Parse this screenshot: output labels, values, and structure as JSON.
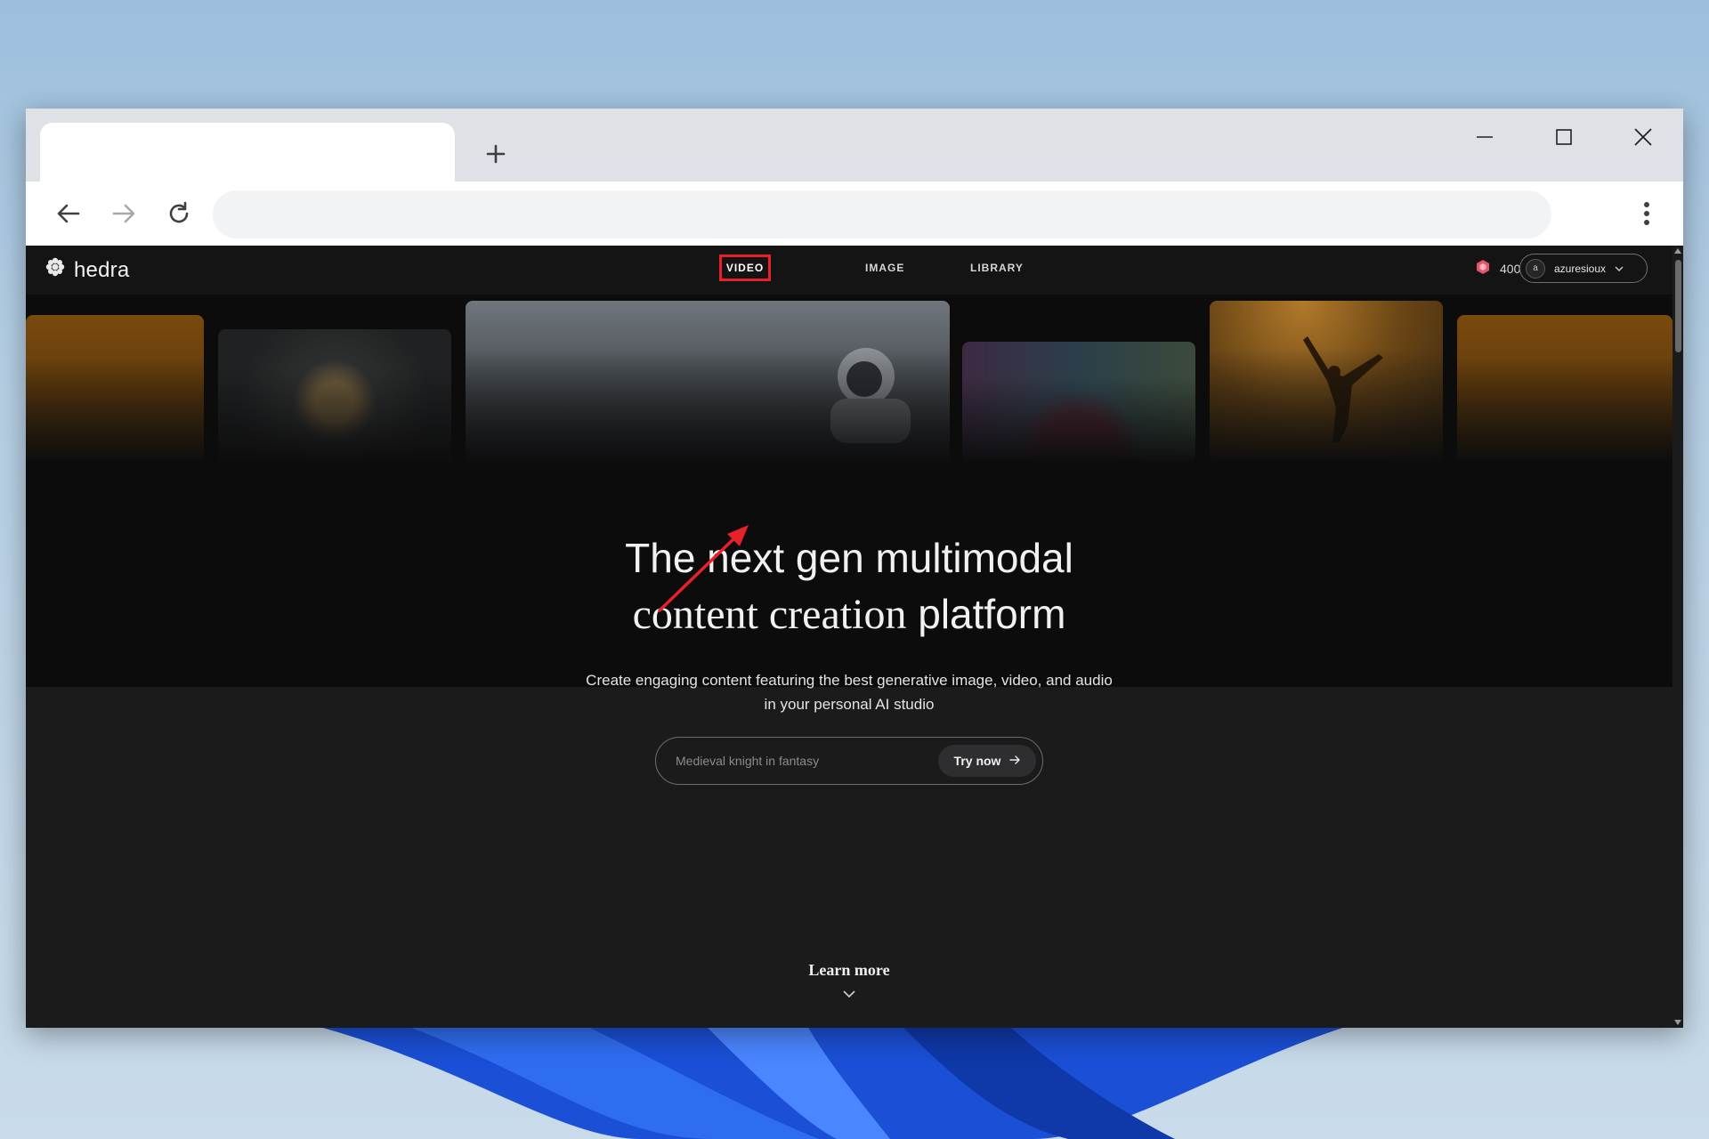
{
  "browser": {
    "new_tab_icon": "plus-icon",
    "window_controls": [
      "minimize-icon",
      "maximize-icon",
      "close-icon"
    ],
    "nav_icons": [
      "back-arrow-icon",
      "forward-arrow-icon",
      "reload-icon",
      "kebab-menu-icon"
    ]
  },
  "site": {
    "logo_text": "hedra",
    "nav": {
      "video": "VIDEO",
      "image": "IMAGE",
      "library": "LIBRARY"
    },
    "credits": "400",
    "user": {
      "initial": "a",
      "name": "azuresioux"
    }
  },
  "hero": {
    "title_line1": "The next gen multimodal",
    "title_line2_serif": "content creation",
    "title_line2_sans": "platform",
    "subtitle": "Create engaging content featuring the best generative image, video, and audio in your personal AI studio"
  },
  "prompt": {
    "placeholder": "Medieval knight in fantasy",
    "button_label": "Try now"
  },
  "footer": {
    "learn_more": "Learn more"
  },
  "colors": {
    "highlight": "#e8202a",
    "page_bg": "#1b1b1c",
    "hero_bg": "#0c0c0d",
    "credit_icon": "#e8536b"
  }
}
